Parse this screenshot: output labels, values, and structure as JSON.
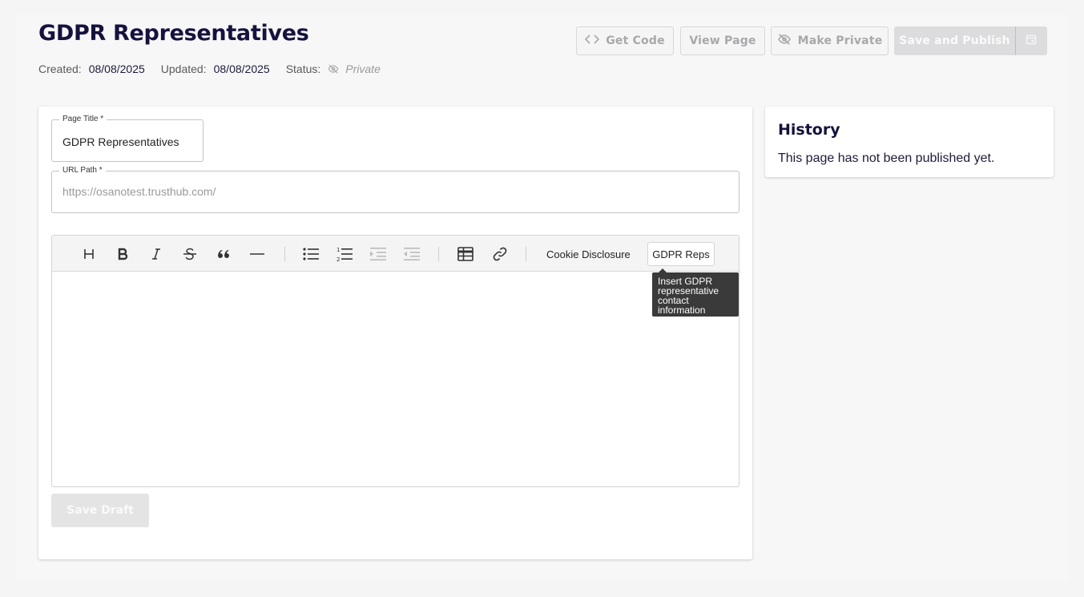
{
  "header": {
    "title": "GDPR Representatives",
    "created_label": "Created:",
    "created_value": "08/08/2025",
    "updated_label": "Updated:",
    "updated_value": "08/08/2025",
    "status_label": "Status:",
    "status_value": "Private",
    "status_icon": "eye-off-icon"
  },
  "actions": {
    "get_code": "Get Code",
    "view_page": "View Page",
    "make_private": "Make Private",
    "save_publish": "Save and Publish"
  },
  "form": {
    "page_title_label": "Page Title *",
    "page_title_value": "GDPR Representatives",
    "url_label": "URL Path *",
    "url_placeholder": "https://osanotest.trusthub.com/"
  },
  "editor": {
    "toolbar_icons": [
      "heading-icon",
      "bold-icon",
      "italic-icon",
      "strikethrough-icon",
      "quote-icon",
      "horizontal-rule-icon",
      "bullet-list-icon",
      "numbered-list-icon",
      "indent-icon",
      "outdent-icon",
      "table-icon",
      "link-icon"
    ],
    "cookie_disclosure": "Cookie Disclosure",
    "gdpr_reps": "GDPR Reps",
    "tooltip": "Insert GDPR representative contact information",
    "save_draft": "Save Draft"
  },
  "history": {
    "title": "History",
    "text": "This page has not been published yet."
  },
  "colors": {
    "title": "#15133d",
    "disabled_button": "#dcdcde",
    "tooltip_bg": "#3a3a3a"
  }
}
